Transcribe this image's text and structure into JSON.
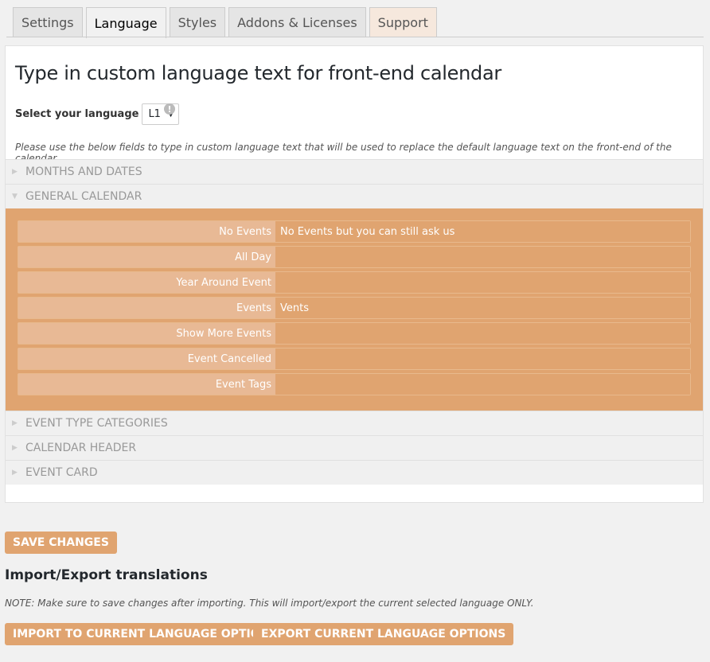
{
  "tabs": [
    {
      "label": "Settings"
    },
    {
      "label": "Language"
    },
    {
      "label": "Styles"
    },
    {
      "label": "Addons & Licenses"
    },
    {
      "label": "Support"
    }
  ],
  "panel": {
    "title": "Type in custom language text for front-end calendar",
    "select_label": "Select your language",
    "select_value": "L1",
    "info_icon": "!",
    "note": "Please use the below fields to type in custom language text that will be used to replace the default language text on the front-end of the calendar."
  },
  "sections": [
    {
      "label": "MONTHS AND DATES",
      "expanded": false
    },
    {
      "label": "GENERAL CALENDAR",
      "expanded": true
    },
    {
      "label": "EVENT TYPE CATEGORIES",
      "expanded": false
    },
    {
      "label": "CALENDAR HEADER",
      "expanded": false
    },
    {
      "label": "EVENT CARD",
      "expanded": false
    }
  ],
  "general_fields": [
    {
      "label": "No Events",
      "value": "No Events but you can still ask us"
    },
    {
      "label": "All Day",
      "value": ""
    },
    {
      "label": "Year Around Event",
      "value": ""
    },
    {
      "label": "Events",
      "value": "Vents"
    },
    {
      "label": "Show More Events",
      "value": ""
    },
    {
      "label": "Event Cancelled",
      "value": ""
    },
    {
      "label": "Event Tags",
      "value": ""
    }
  ],
  "buttons": {
    "save": "SAVE CHANGES",
    "import": "IMPORT TO CURRENT LANGUAGE OPTIONS",
    "export": "EXPORT CURRENT LANGUAGE OPTIONS"
  },
  "import_export": {
    "title": "Import/Export translations",
    "note": "NOTE: Make sure to save changes after importing. This will import/export the current selected language ONLY."
  },
  "colors": {
    "accent": "#e0a470",
    "accent_light": "#e8b995"
  }
}
